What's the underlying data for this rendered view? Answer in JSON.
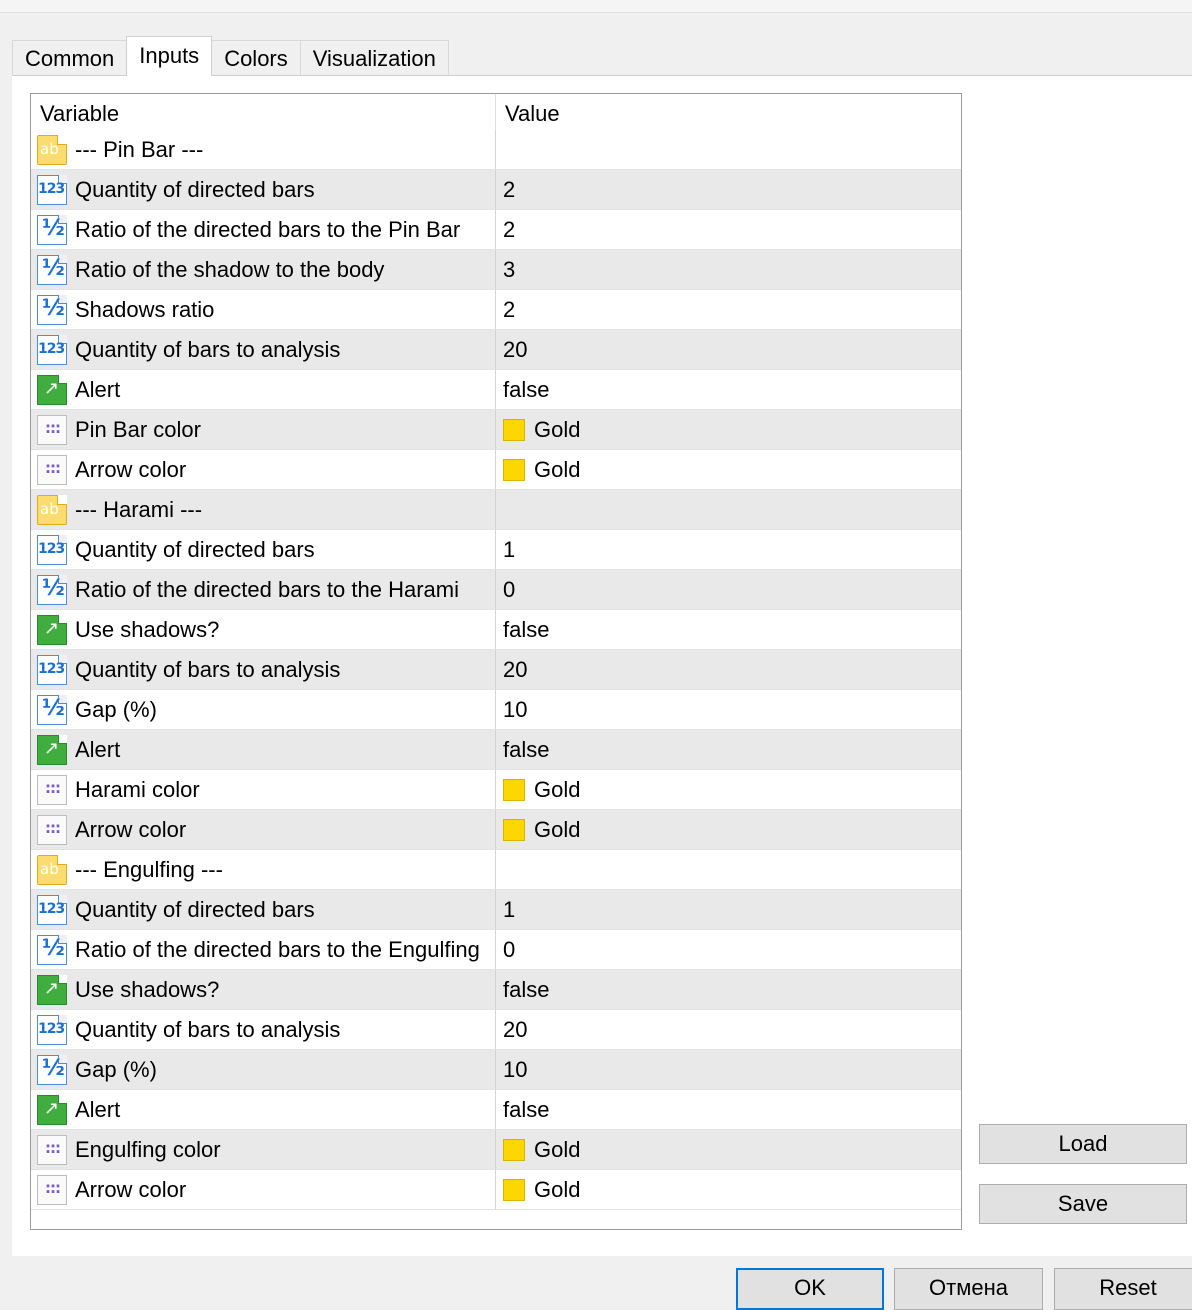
{
  "tabs": [
    {
      "label": "Common"
    },
    {
      "label": "Inputs"
    },
    {
      "label": "Colors"
    },
    {
      "label": "Visualization"
    }
  ],
  "table": {
    "headers": {
      "variable": "Variable",
      "value": "Value"
    },
    "rows": [
      {
        "type": "string",
        "label": "--- Pin Bar ---",
        "value": ""
      },
      {
        "type": "int",
        "label": "Quantity of directed bars",
        "value": "2"
      },
      {
        "type": "double",
        "label": "Ratio of the directed bars to the Pin Bar",
        "value": "2"
      },
      {
        "type": "double",
        "label": "Ratio of the shadow to the body",
        "value": "3"
      },
      {
        "type": "double",
        "label": "Shadows ratio",
        "value": "2"
      },
      {
        "type": "int",
        "label": "Quantity of bars to analysis",
        "value": "20"
      },
      {
        "type": "bool",
        "label": "Alert",
        "value": "false"
      },
      {
        "type": "color",
        "label": "Pin Bar color",
        "value": "Gold",
        "color": "#FFD700"
      },
      {
        "type": "color",
        "label": "Arrow color",
        "value": "Gold",
        "color": "#FFD700"
      },
      {
        "type": "string",
        "label": "--- Harami ---",
        "value": ""
      },
      {
        "type": "int",
        "label": "Quantity of directed bars",
        "value": "1"
      },
      {
        "type": "double",
        "label": "Ratio of the directed bars to the Harami",
        "value": "0"
      },
      {
        "type": "bool",
        "label": "Use shadows?",
        "value": "false"
      },
      {
        "type": "int",
        "label": "Quantity of bars to analysis",
        "value": "20"
      },
      {
        "type": "double",
        "label": "Gap (%)",
        "value": "10"
      },
      {
        "type": "bool",
        "label": "Alert",
        "value": "false"
      },
      {
        "type": "color",
        "label": "Harami color",
        "value": "Gold",
        "color": "#FFD700"
      },
      {
        "type": "color",
        "label": "Arrow color",
        "value": "Gold",
        "color": "#FFD700"
      },
      {
        "type": "string",
        "label": "--- Engulfing ---",
        "value": ""
      },
      {
        "type": "int",
        "label": "Quantity of directed bars",
        "value": "1"
      },
      {
        "type": "double",
        "label": "Ratio of the directed bars to the Engulfing",
        "value": "0"
      },
      {
        "type": "bool",
        "label": "Use shadows?",
        "value": "false"
      },
      {
        "type": "int",
        "label": "Quantity of bars to analysis",
        "value": "20"
      },
      {
        "type": "double",
        "label": "Gap (%)",
        "value": "10"
      },
      {
        "type": "bool",
        "label": "Alert",
        "value": "false"
      },
      {
        "type": "color",
        "label": "Engulfing color",
        "value": "Gold",
        "color": "#FFD700"
      },
      {
        "type": "color",
        "label": "Arrow color",
        "value": "Gold",
        "color": "#FFD700"
      }
    ]
  },
  "side_buttons": {
    "load": "Load",
    "save": "Save"
  },
  "footer_buttons": {
    "ok": "OK",
    "cancel": "Отмена",
    "reset": "Reset"
  }
}
